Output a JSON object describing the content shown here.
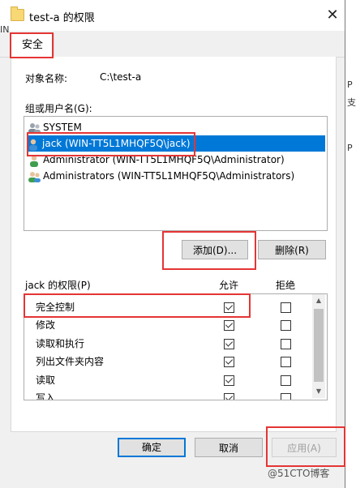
{
  "window": {
    "title": "test-a 的权限",
    "close_glyph": "✕"
  },
  "tabs": [
    {
      "label": "安全"
    }
  ],
  "object": {
    "label": "对象名称:",
    "value": "C:\\test-a"
  },
  "groups": {
    "label": "组或用户名(G):",
    "items": [
      {
        "name": "SYSTEM",
        "icon": "user-group-icon",
        "selected": false
      },
      {
        "name": "jack (WIN-TT5L1MHQF5Q\\jack)",
        "icon": "user-icon",
        "selected": true
      },
      {
        "name": "Administrator (WIN-TT5L1MHQF5Q\\Administrator)",
        "icon": "user-icon",
        "selected": false
      },
      {
        "name": "Administrators (WIN-TT5L1MHQF5Q\\Administrators)",
        "icon": "user-group-icon",
        "selected": false
      }
    ]
  },
  "buttons": {
    "add": "添加(D)...",
    "remove": "删除(R)",
    "ok": "确定",
    "cancel": "取消",
    "apply": "应用(A)"
  },
  "permissions": {
    "label": "jack 的权限(P)",
    "allow_header": "允许",
    "deny_header": "拒绝",
    "rows": [
      {
        "name": "完全控制",
        "allow": true,
        "deny": false
      },
      {
        "name": "修改",
        "allow": true,
        "deny": false
      },
      {
        "name": "读取和执行",
        "allow": true,
        "deny": false
      },
      {
        "name": "列出文件夹内容",
        "allow": true,
        "deny": false
      },
      {
        "name": "读取",
        "allow": true,
        "deny": false
      },
      {
        "name": "写入",
        "allow": true,
        "deny": false
      }
    ]
  },
  "watermark": "@51CTO博客",
  "edge_text": [
    "IN",
    "P",
    "支",
    "P"
  ],
  "colors": {
    "selection": "#0078d7",
    "highlight": "#e53535"
  }
}
